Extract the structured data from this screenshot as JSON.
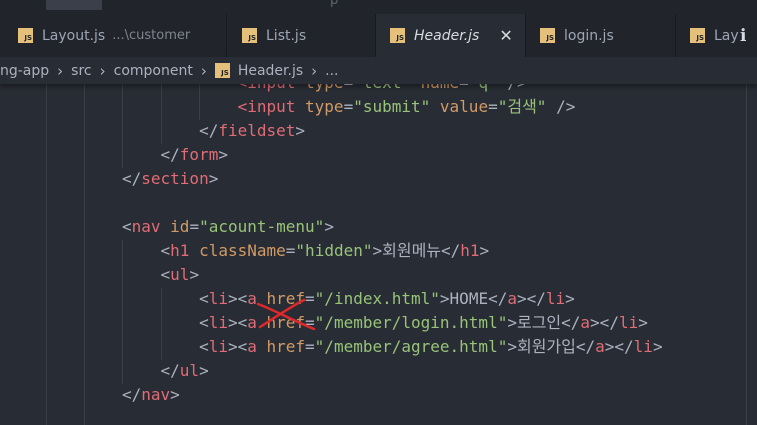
{
  "top_strip": {
    "ghost_text": "p"
  },
  "tabs": [
    {
      "name": "Layout.js",
      "desc": "...\\customer",
      "active": false,
      "italic": false
    },
    {
      "name": "List.js",
      "desc": "",
      "active": false,
      "italic": false
    },
    {
      "name": "Header.js",
      "desc": "",
      "active": true,
      "italic": true,
      "close": "✕"
    },
    {
      "name": "login.js",
      "desc": "",
      "active": false,
      "italic": false
    },
    {
      "name": "Lay",
      "desc": "",
      "active": false,
      "italic": false
    }
  ],
  "tab_icon_text": "JS",
  "overflow_icon": "ℹ",
  "breadcrumb": {
    "segments": [
      "ng-app",
      "src",
      "component",
      "Header.js",
      "..."
    ],
    "separator": "›"
  },
  "code_lines": [
    [
      [
        "indent",
        "            "
      ],
      [
        "tag",
        "<input "
      ],
      [
        "attr",
        "type"
      ],
      [
        "punct",
        "="
      ],
      [
        "str",
        "\"text\""
      ],
      [
        "punct",
        " "
      ],
      [
        "attr",
        "name"
      ],
      [
        "punct",
        "="
      ],
      [
        "str",
        "\"q\""
      ],
      [
        "punct",
        " />"
      ]
    ],
    [
      [
        "indent",
        "            "
      ],
      [
        "tag",
        "<input "
      ],
      [
        "attr",
        "type"
      ],
      [
        "punct",
        "="
      ],
      [
        "str",
        "\"submit\""
      ],
      [
        "punct",
        " "
      ],
      [
        "attr",
        "value"
      ],
      [
        "punct",
        "="
      ],
      [
        "str",
        "\"검색\""
      ],
      [
        "punct",
        " />"
      ]
    ],
    [
      [
        "indent",
        "        "
      ],
      [
        "punct",
        "</"
      ],
      [
        "tag",
        "fieldset"
      ],
      [
        "punct",
        ">"
      ]
    ],
    [
      [
        "indent",
        "    "
      ],
      [
        "punct",
        "</"
      ],
      [
        "tag",
        "form"
      ],
      [
        "punct",
        ">"
      ]
    ],
    [
      [
        "indent",
        ""
      ],
      [
        "punct",
        "</"
      ],
      [
        "tag",
        "section"
      ],
      [
        "punct",
        ">"
      ]
    ],
    [
      [
        "indent",
        ""
      ]
    ],
    [
      [
        "indent",
        ""
      ],
      [
        "punct",
        "<"
      ],
      [
        "tag",
        "nav "
      ],
      [
        "attr",
        "id"
      ],
      [
        "punct",
        "="
      ],
      [
        "str",
        "\"acount-menu\""
      ],
      [
        "punct",
        ">"
      ]
    ],
    [
      [
        "indent",
        "    "
      ],
      [
        "punct",
        "<"
      ],
      [
        "tag",
        "h1 "
      ],
      [
        "attr",
        "className"
      ],
      [
        "punct",
        "="
      ],
      [
        "str",
        "\"hidden\""
      ],
      [
        "punct",
        ">"
      ],
      [
        "text",
        "회원메뉴"
      ],
      [
        "punct",
        "</"
      ],
      [
        "tag",
        "h1"
      ],
      [
        "punct",
        ">"
      ]
    ],
    [
      [
        "indent",
        "    "
      ],
      [
        "punct",
        "<"
      ],
      [
        "tag",
        "ul"
      ],
      [
        "punct",
        ">"
      ]
    ],
    [
      [
        "indent",
        "        "
      ],
      [
        "punct",
        "<"
      ],
      [
        "tag",
        "li"
      ],
      [
        "punct",
        "><"
      ],
      [
        "tag",
        "a "
      ],
      [
        "attr",
        "href"
      ],
      [
        "punct",
        "="
      ],
      [
        "str",
        "\"/index.html\""
      ],
      [
        "punct",
        ">"
      ],
      [
        "text",
        "HOME"
      ],
      [
        "punct",
        "</"
      ],
      [
        "tag",
        "a"
      ],
      [
        "punct",
        "></"
      ],
      [
        "tag",
        "li"
      ],
      [
        "punct",
        ">"
      ]
    ],
    [
      [
        "indent",
        "        "
      ],
      [
        "punct",
        "<"
      ],
      [
        "tag",
        "li"
      ],
      [
        "punct",
        "><"
      ],
      [
        "tag",
        "a "
      ],
      [
        "attr",
        "href"
      ],
      [
        "punct",
        "="
      ],
      [
        "str",
        "\"/member/login.html\""
      ],
      [
        "punct",
        ">"
      ],
      [
        "text",
        "로그인"
      ],
      [
        "punct",
        "</"
      ],
      [
        "tag",
        "a"
      ],
      [
        "punct",
        "></"
      ],
      [
        "tag",
        "li"
      ],
      [
        "punct",
        ">"
      ]
    ],
    [
      [
        "indent",
        "        "
      ],
      [
        "punct",
        "<"
      ],
      [
        "tag",
        "li"
      ],
      [
        "punct",
        "><"
      ],
      [
        "tag",
        "a "
      ],
      [
        "attr",
        "href"
      ],
      [
        "punct",
        "="
      ],
      [
        "str",
        "\"/member/agree.html\""
      ],
      [
        "punct",
        ">"
      ],
      [
        "text",
        "회원가입"
      ],
      [
        "punct",
        "</"
      ],
      [
        "tag",
        "a"
      ],
      [
        "punct",
        "></"
      ],
      [
        "tag",
        "li"
      ],
      [
        "punct",
        ">"
      ]
    ],
    [
      [
        "indent",
        "    "
      ],
      [
        "punct",
        "</"
      ],
      [
        "tag",
        "ul"
      ],
      [
        "punct",
        ">"
      ]
    ],
    [
      [
        "indent",
        ""
      ],
      [
        "punct",
        "</"
      ],
      [
        "tag",
        "nav"
      ],
      [
        "punct",
        ">"
      ]
    ]
  ],
  "colors": {
    "background": "#282c34",
    "tabbar": "#21252b",
    "tag": "#e06c75",
    "attribute": "#d19a66",
    "string": "#98c379",
    "js_badge": "#e5c07b",
    "annotation": "#e0282c"
  }
}
